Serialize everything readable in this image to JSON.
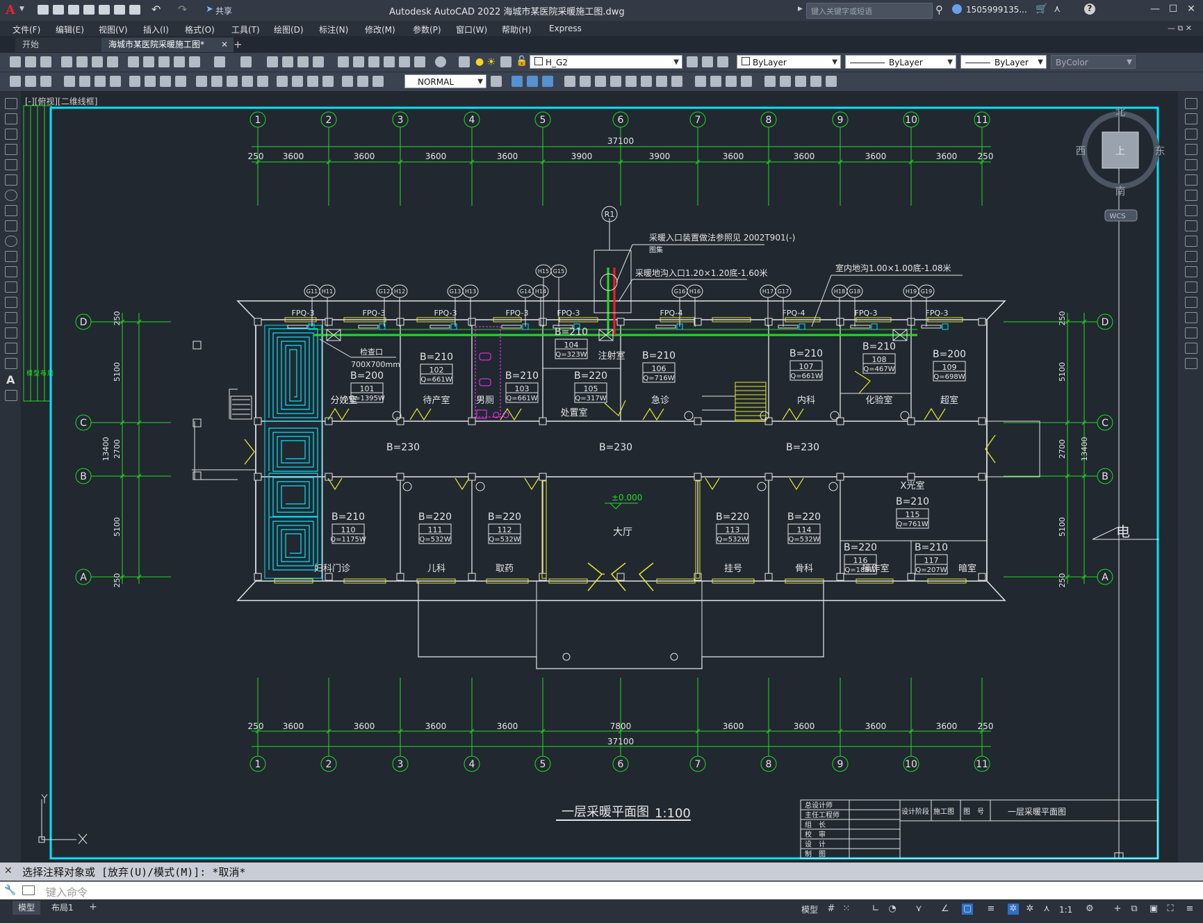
{
  "app": {
    "logo": "A",
    "title": "Autodesk AutoCAD 2022    海城市某医院采暖施工图.dwg",
    "share": "共享",
    "search_placeholder": "键入关键字或短语",
    "user": "1505999135...",
    "window_controls": [
      "—",
      "☐",
      "✕"
    ]
  },
  "menu": [
    "文件(F)",
    "编辑(E)",
    "视图(V)",
    "插入(I)",
    "格式(O)",
    "工具(T)",
    "绘图(D)",
    "标注(N)",
    "修改(M)",
    "参数(P)",
    "窗口(W)",
    "帮助(H)",
    "Express"
  ],
  "tabs": [
    {
      "label": "开始",
      "active": false
    },
    {
      "label": "海城市某医院采暖施工图*",
      "active": true
    }
  ],
  "toolbar": {
    "layer": "H_G2",
    "color": "ByLayer",
    "linetype": "ByLayer",
    "lineweight": "ByLayer",
    "plotstyle": "ByColor",
    "dimstyle": "NORMAL"
  },
  "viewport_label": "[-][俯视][二维线框]",
  "viewcube": {
    "north": "北",
    "south": "南",
    "east": "东",
    "west": "西",
    "face": "上",
    "wcs": "WCS"
  },
  "drawing": {
    "grid_top": [
      "1",
      "2",
      "3",
      "4",
      "5",
      "6",
      "7",
      "8",
      "9",
      "10",
      "11"
    ],
    "grid_side": [
      "D",
      "C",
      "B",
      "A"
    ],
    "overall_dim": "37100",
    "top_dims": [
      "250",
      "3600",
      "3600",
      "3600",
      "3600",
      "3900",
      "3900",
      "3600",
      "3600",
      "3600",
      "3600",
      "250"
    ],
    "bottom_dims": [
      "250",
      "3600",
      "3600",
      "3600",
      "3600",
      "7800",
      "3600",
      "3600",
      "3600",
      "3600",
      "250"
    ],
    "side_dims": [
      "250",
      "5100",
      "2700",
      "5100",
      "250"
    ],
    "side_total": "13400",
    "riser": "R1",
    "note1": "采暖入口装置做法参照见 2002T901(-)",
    "note1b": "图集",
    "note2": "采暖地沟入口1.20×1.20底-1.60米",
    "note3": "室内地沟1.00×1.00底-1.08米",
    "inspect": "检查口",
    "inspect_size": "700X700mm",
    "corridor": "B=230",
    "elev": "±0.000",
    "hall": "大厅",
    "title": "一层采暖平面图",
    "scale": "1:100",
    "elec": "电",
    "fpq": [
      "FPQ-3",
      "FPQ-3",
      "FPQ-3",
      "FPQ-3",
      "FPQ-3",
      "FPQ-4",
      "FPQ-4",
      "FPQ-3",
      "FPQ-3"
    ],
    "tags": [
      "G11",
      "H11",
      "G12",
      "H12",
      "G13",
      "H13",
      "G14",
      "H14",
      "H15",
      "G15",
      "G16",
      "H16",
      "H17",
      "G17",
      "H18",
      "G18",
      "H19",
      "G19"
    ],
    "rooms": [
      {
        "b": "B=200",
        "n": "101",
        "q": "Q=1395W",
        "name": "分娩室"
      },
      {
        "b": "B=210",
        "n": "102",
        "q": "Q=661W",
        "name": "待产室"
      },
      {
        "b": "B=210",
        "n": "103",
        "q": "Q=661W",
        "name": "男厕"
      },
      {
        "b": "B=210",
        "n": "104",
        "q": "Q=323W",
        "name": "注射室"
      },
      {
        "b": "B=220",
        "n": "105",
        "q": "Q=317W",
        "name": "处置室"
      },
      {
        "b": "B=210",
        "n": "106",
        "q": "Q=716W",
        "name": "急诊"
      },
      {
        "b": "B=210",
        "n": "107",
        "q": "Q=661W",
        "name": "内科"
      },
      {
        "b": "B=210",
        "n": "108",
        "q": "Q=467W",
        "name": "化验室"
      },
      {
        "b": "B=200",
        "n": "109",
        "q": "Q=698W",
        "name": "超室"
      },
      {
        "b": "B=210",
        "n": "110",
        "q": "Q=1175W",
        "name": "妇科门诊"
      },
      {
        "b": "B=220",
        "n": "111",
        "q": "Q=532W",
        "name": "儿科"
      },
      {
        "b": "B=220",
        "n": "112",
        "q": "Q=532W",
        "name": "取药"
      },
      {
        "b": "B=220",
        "n": "113",
        "q": "Q=532W",
        "name": "挂号"
      },
      {
        "b": "B=220",
        "n": "114",
        "q": "Q=532W",
        "name": "骨科"
      },
      {
        "b": "B=210",
        "n": "115",
        "q": "Q=761W",
        "name": "X光室"
      },
      {
        "b": "B=220",
        "n": "116",
        "q": "Q=188W",
        "name": "操作室"
      },
      {
        "b": "B=210",
        "n": "117",
        "q": "Q=207W",
        "name": "暗室"
      }
    ],
    "titleblock": {
      "rows": [
        "总设计师",
        "主任工程师",
        "组　长",
        "校　审",
        "设　计",
        "制　图"
      ],
      "stage": "设计阶段",
      "stage_val": "施工图",
      "no": "图　号",
      "name": "一层采暖平面图"
    },
    "left_labels": [
      "模",
      "型",
      "布",
      "局"
    ]
  },
  "command": {
    "history": "选择注释对象或 [放弃(U)/模式(M)]: *取消*",
    "placeholder": "键入命令"
  },
  "layouts": [
    {
      "label": "模型",
      "active": true
    },
    {
      "label": "布局1",
      "active": false
    }
  ],
  "status": {
    "model": "模型",
    "scale": "1:1"
  },
  "colors": {
    "accent": "#00e5ff",
    "grid_green": "#22dd22",
    "pipe_red": "#ee2222",
    "wall_white": "#e6e6e6",
    "yellow": "#e8e82a",
    "magenta": "#ff33ff"
  }
}
